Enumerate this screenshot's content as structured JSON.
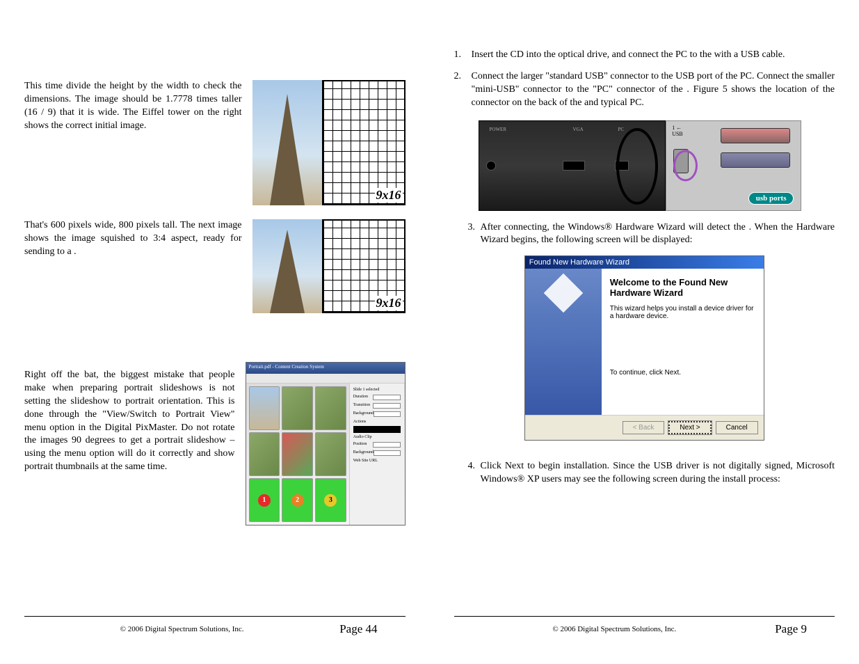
{
  "left": {
    "para1": "This time divide the height by the width to check the dimensions. The image should be 1.7778 times taller (16 / 9) that it is wide. The Eiffel tower on the right shows the correct initial image.",
    "para2": "That's 600 pixels wide, 800 pixels tall. The next image shows the image squished to 3:4 aspect, ready for sending to a               .",
    "para3": "Right off the bat, the biggest mistake that people make when preparing portrait slideshows is not setting the slideshow to portrait orientation. This is done through the \"View/Switch to Portrait View\" menu option in the Digital PixMaster. Do not rotate the images 90 degrees to get a portrait slideshow – using the menu option will do it correctly and show portrait thumbnails at the same time.",
    "grid_label": "9x16",
    "footer_copyright": "© 2006 Digital Spectrum Solutions, Inc.",
    "footer_page": "Page 44"
  },
  "right": {
    "step1": "Insert the                        CD into the optical drive, and connect the PC to the                     with a USB cable.",
    "step2": "Connect the larger \"standard USB\" connector to the USB port of the PC. Connect the smaller \"mini-USB\" connector to the \"PC\" connector of the                    . Figure 5 shows the location of the connector on the back of the                        and typical PC.",
    "step3": "After connecting, the Windows® Hardware Wizard will detect the                  . When the Hardware Wizard begins, the following screen will be displayed:",
    "step4": "Click Next to begin installation. Since the                        USB driver is not digitally signed, Microsoft Windows® XP users may see the following screen during the install process:",
    "usb_ports_label": "usb ports",
    "port_power": "POWER",
    "port_vga": "VGA",
    "port_pc": "PC",
    "wizard_title": "Found New Hardware Wizard",
    "wizard_heading": "Welcome to the Found New Hardware Wizard",
    "wizard_text": "This wizard helps you install a device driver for a hardware device.",
    "wizard_continue": "To continue, click Next.",
    "wizard_back": "< Back",
    "wizard_next": "Next >",
    "wizard_cancel": "Cancel",
    "footer_copyright": "© 2006 Digital Spectrum Solutions, Inc.",
    "footer_page": "Page 9"
  }
}
